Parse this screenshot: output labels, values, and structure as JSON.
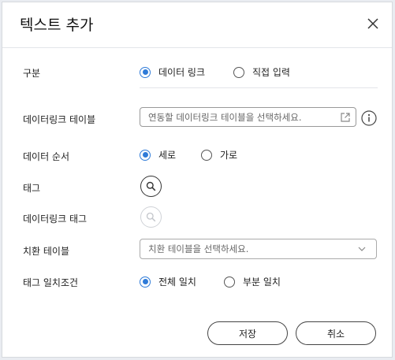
{
  "dialog": {
    "title": "텍스트 추가",
    "close_icon": "close-icon"
  },
  "form": {
    "category": {
      "label": "구분",
      "options": [
        "데이터 링크",
        "직접 입력"
      ],
      "selected": "데이터 링크"
    },
    "datalink_table": {
      "label": "데이터링크 테이블",
      "placeholder": "연동할 데이터링크 테이블을 선택하세요.",
      "open_icon": "external-link-icon",
      "info_icon": "info-icon"
    },
    "data_order": {
      "label": "데이터 순서",
      "options": [
        "세로",
        "가로"
      ],
      "selected": "세로"
    },
    "tag": {
      "label": "태그",
      "icon": "search-icon"
    },
    "datalink_tag": {
      "label": "데이터링크 태그",
      "icon": "search-icon"
    },
    "replace_table": {
      "label": "치환 테이블",
      "placeholder": "치환 테이블을 선택하세요.",
      "icon": "chevron-down-icon"
    },
    "tag_match": {
      "label": "태그 일치조건",
      "options": [
        "전체 일치",
        "부분 일치"
      ],
      "selected": "전체 일치"
    }
  },
  "footer": {
    "save_label": "저장",
    "cancel_label": "취소"
  },
  "colors": {
    "accent": "#2f7bd8",
    "border": "#999999",
    "disabled": "#c8cbd0"
  }
}
